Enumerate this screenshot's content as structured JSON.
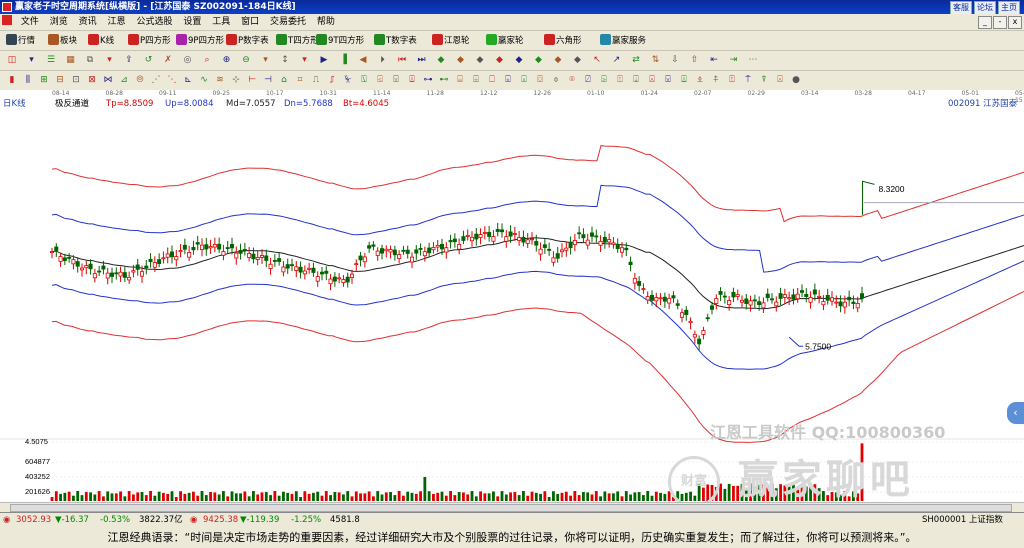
{
  "titlebar": {
    "title": "赢家老子时空周期系统[纵横版] - [江苏国泰  SZ002091-184日K线]",
    "links": [
      "客服",
      "论坛",
      "主页"
    ]
  },
  "menu": [
    "文件",
    "浏览",
    "资讯",
    "江恩",
    "公式选股",
    "设置",
    "工具",
    "窗口",
    "交易委托",
    "帮助"
  ],
  "window_buttons": [
    "_",
    "-",
    "x"
  ],
  "toolbar": [
    {
      "label": "行情",
      "icon": "grid-icon",
      "color": "#345"
    },
    {
      "label": "板块",
      "icon": "blocks-icon",
      "color": "#a52"
    },
    {
      "label": "K线",
      "icon": "kline-icon",
      "color": "#c22"
    },
    {
      "label": "P四方形",
      "icon": "square-p-icon",
      "color": "#c22"
    },
    {
      "label": "9P四方形",
      "icon": "square-9p-icon",
      "color": "#a2a"
    },
    {
      "label": "P数字表",
      "icon": "table-p-icon",
      "color": "#c22"
    },
    {
      "label": "T四方形",
      "icon": "square-t-icon",
      "color": "#282"
    },
    {
      "label": "9T四方形",
      "icon": "square-9t-icon",
      "color": "#282"
    },
    {
      "label": "T数字表",
      "icon": "table-t-icon",
      "color": "#282"
    },
    {
      "label": "江恩轮",
      "icon": "wheel-icon",
      "color": "#c22"
    },
    {
      "label": "赢家轮",
      "icon": "wheel2-icon",
      "color": "#2a2"
    },
    {
      "label": "六角形",
      "icon": "hexagon-icon",
      "color": "#c22"
    },
    {
      "label": "赢家服务",
      "icon": "service-icon",
      "color": "#28a"
    }
  ],
  "date_axis": [
    "08-14",
    "08-28",
    "09-11",
    "09-25",
    "10-17",
    "10-31",
    "11-14",
    "11-28",
    "12-12",
    "12-26",
    "01-10",
    "01-24",
    "02-07",
    "02-29",
    "03-14",
    "03-28",
    "04-17",
    "05-01",
    "05-15"
  ],
  "info": {
    "period": "日K线",
    "indicator": "极反通道",
    "tp": "Tp=8.8509",
    "up": "Up=8.0084",
    "md": "Md=7.0557",
    "dn": "Dn=5.7688",
    "bt": "Bt=4.6045",
    "stock": "002091  江苏国泰"
  },
  "chart_data": {
    "type": "candlestick",
    "indicator": "极反通道",
    "bands": {
      "tp": 8.8509,
      "up": 8.0084,
      "md": 7.0557,
      "dn": 5.7688,
      "bt": 4.6045
    },
    "high_marker": 8.32,
    "low_marker": 5.75,
    "volume_ticks": [
      4.5075,
      604877,
      403252,
      201626
    ],
    "annotations": [
      "8.3200",
      "5.7500"
    ]
  },
  "colors": {
    "up": "#e00000",
    "down": "#006400",
    "tp": "#e03030",
    "up_band": "#2233cc",
    "md": "#222222"
  },
  "watermark": {
    "line1": "江恩工具软件 QQ:100800360",
    "line2": "赢家聊吧",
    "seal": "财富"
  },
  "status": {
    "sh": "3052.93",
    "sh_chg": "▼-16.37",
    "sh_pct": "-0.53%",
    "sh_amt": "3822.37亿",
    "sz": "9425.38",
    "sz_chg": "▼-119.39",
    "sz_pct": "-1.25%",
    "sz_amt": "4581.8",
    "code": "SH000001 上证指数"
  },
  "quote": "江恩经典语录：“时间是决定市场走势的重要因素，经过详细研究大市及个别股票的过往记录，你将可以证明，历史确实重复发生；而了解过往，你将可以预测将来。”。"
}
